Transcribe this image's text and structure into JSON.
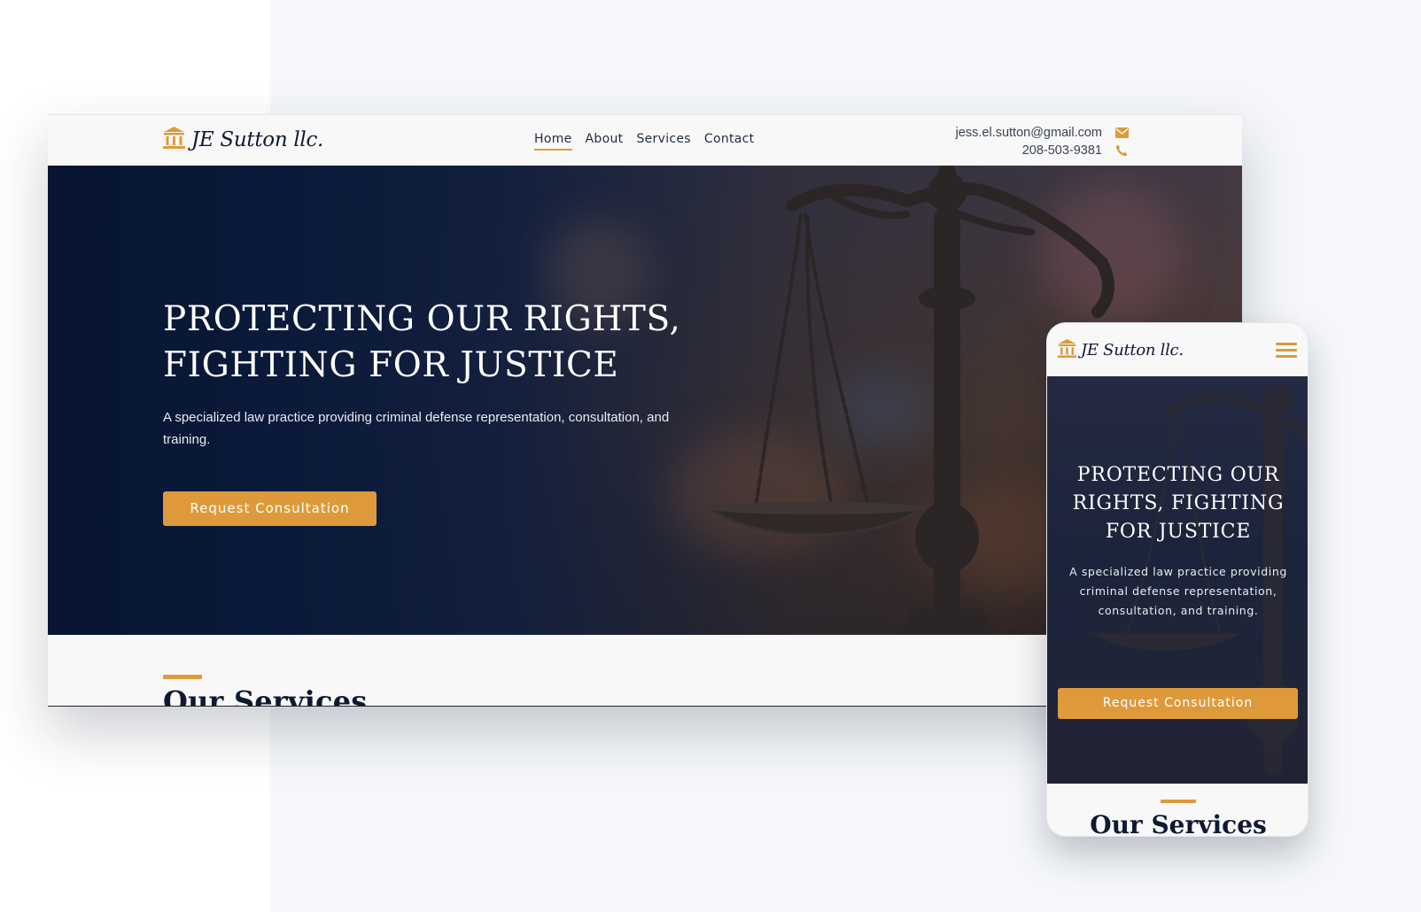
{
  "brand": {
    "name": "JE Sutton llc.",
    "accent_color": "#de9a3a",
    "navy_color": "#0e1a33",
    "logo_icon": "courthouse-icon"
  },
  "desktop": {
    "nav": [
      {
        "label": "Home",
        "active": true
      },
      {
        "label": "About",
        "active": false
      },
      {
        "label": "Services",
        "active": false
      },
      {
        "label": "Contact",
        "active": false
      }
    ],
    "contact": {
      "email": "jess.el.sutton@gmail.com",
      "email_icon": "mail-icon",
      "phone": "208-503-9381",
      "phone_icon": "phone-icon"
    },
    "hero": {
      "title_line1": "PROTECTING OUR RIGHTS,",
      "title_line2": "FIGHTING FOR JUSTICE",
      "subtitle": "A specialized law practice providing criminal defense representation, consultation, and training.",
      "cta": "Request Consultation"
    },
    "services_heading": "Our Services"
  },
  "mobile": {
    "menu_icon": "hamburger-menu-icon",
    "hero": {
      "title": "PROTECTING OUR RIGHTS, FIGHTING FOR JUSTICE",
      "subtitle": "A specialized law practice providing criminal defense representation, consultation, and training.",
      "cta": "Request Consultation"
    },
    "services_heading": "Our Services"
  }
}
